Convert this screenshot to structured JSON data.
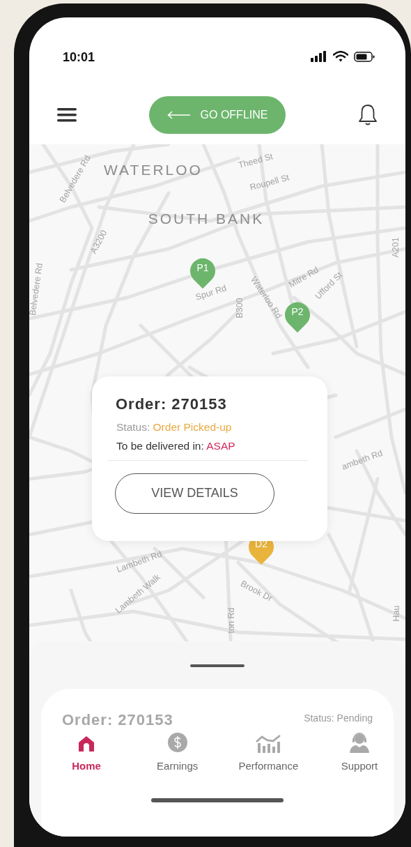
{
  "status_bar": {
    "time": "10:01"
  },
  "header": {
    "offline_button": {
      "label": "GO OFFLINE"
    }
  },
  "map": {
    "labels": [
      {
        "kind": "area",
        "text": "WATERLOO"
      },
      {
        "kind": "area",
        "text": "SOUTH BANK"
      },
      {
        "kind": "street",
        "text": "Theed St"
      },
      {
        "kind": "street",
        "text": "Roupell St"
      },
      {
        "kind": "street",
        "text": "Belvedere Rd"
      },
      {
        "kind": "street",
        "text": "Belvedere Rd"
      },
      {
        "kind": "street",
        "text": "A3200"
      },
      {
        "kind": "street",
        "text": "A201"
      },
      {
        "kind": "street",
        "text": "Spur Rd"
      },
      {
        "kind": "street",
        "text": "B300"
      },
      {
        "kind": "street",
        "text": "Waterloo Rd"
      },
      {
        "kind": "street",
        "text": "Mitre Rd"
      },
      {
        "kind": "street",
        "text": "Ufford St"
      },
      {
        "kind": "street",
        "text": "ambeth Rd"
      },
      {
        "kind": "street",
        "text": "Lambeth Rd"
      },
      {
        "kind": "street",
        "text": "Lambeth Walk"
      },
      {
        "kind": "street",
        "text": "Brook Dr"
      },
      {
        "kind": "street",
        "text": "ton Rd"
      },
      {
        "kind": "street",
        "text": "Hau"
      }
    ],
    "pins": [
      {
        "label": "P1",
        "color": "#6db56d"
      },
      {
        "label": "P2",
        "color": "#6db56d"
      },
      {
        "label": "D2",
        "color": "#e9b43c"
      }
    ]
  },
  "order_card": {
    "title": "Order: 270153",
    "status_label": "Status:",
    "status": "Order Picked-up",
    "delivery_label": "To be delivered in:",
    "delivery": "ASAP",
    "button": "VIEW DETAILS"
  },
  "bottom_sheet": {
    "peek_title": "Order: 270153",
    "peek_status": "Status: Pending"
  },
  "nav": [
    {
      "kind": "home",
      "label": "Home",
      "selected": true
    },
    {
      "kind": "earnings",
      "label": "Earnings",
      "selected": false
    },
    {
      "kind": "performance",
      "label": "Performance",
      "selected": false
    },
    {
      "kind": "support",
      "label": "Support",
      "selected": false
    }
  ]
}
